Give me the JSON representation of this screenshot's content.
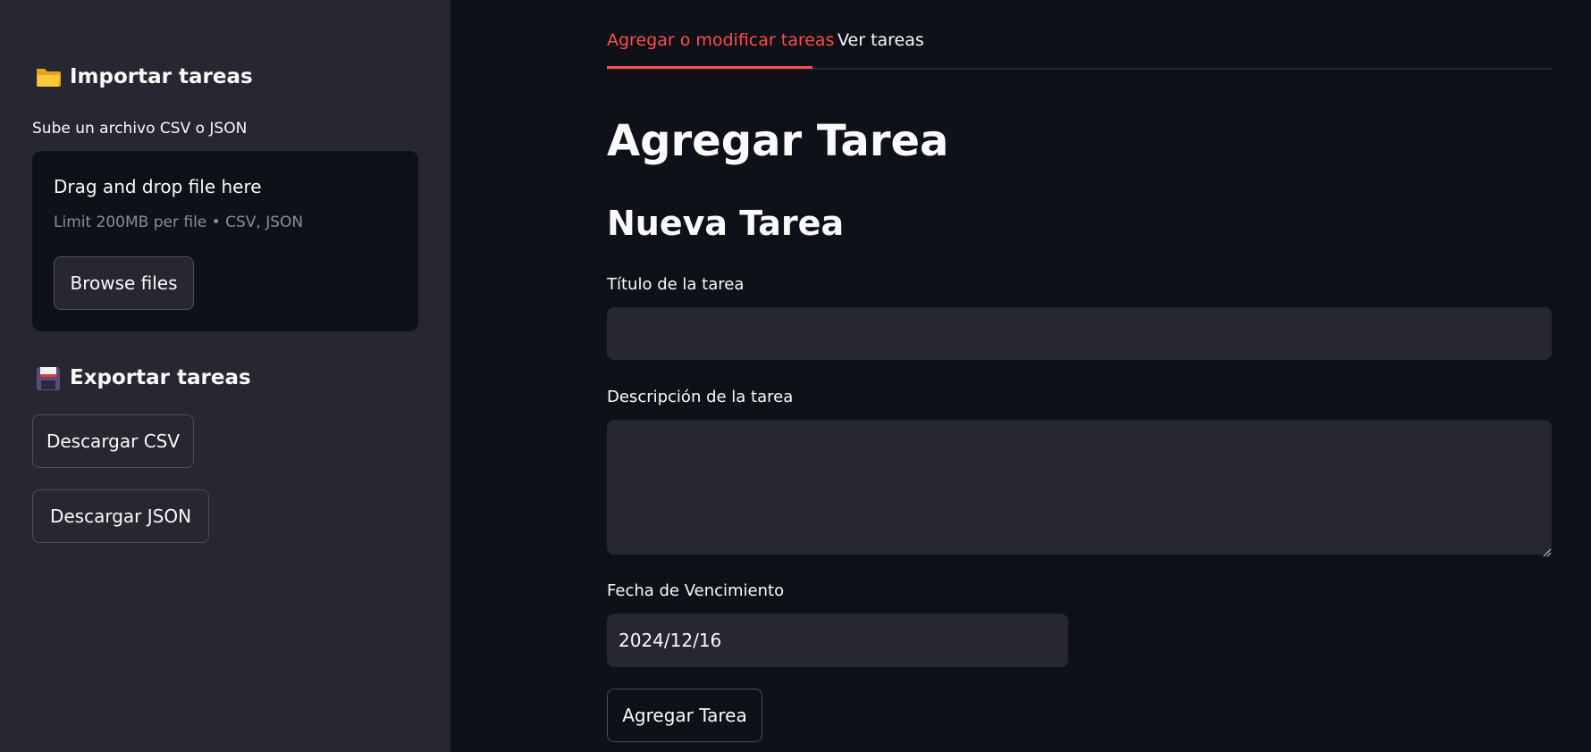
{
  "sidebar": {
    "import": {
      "heading": "Importar tareas",
      "icon": "folder-icon",
      "upload_label": "Sube un archivo CSV o JSON",
      "dropzone_title": "Drag and drop file here",
      "dropzone_limit": "Limit 200MB per file • CSV, JSON",
      "browse_label": "Browse files"
    },
    "export": {
      "heading": "Exportar tareas",
      "icon": "floppy-disk-icon",
      "csv_label": "Descargar CSV",
      "json_label": "Descargar JSON"
    }
  },
  "main": {
    "tabs": [
      {
        "label": "Agregar o modificar tareas",
        "active": true
      },
      {
        "label": "Ver tareas",
        "active": false
      }
    ],
    "page_title": "Agregar Tarea",
    "form_title": "Nueva Tarea",
    "fields": {
      "title_label": "Título de la tarea",
      "title_value": "",
      "description_label": "Descripción de la tarea",
      "description_value": "",
      "due_date_label": "Fecha de Vencimiento",
      "due_date_value": "2024/12/16"
    },
    "submit_label": "Agregar Tarea"
  },
  "colors": {
    "accent": "#ff4b4b",
    "sidebar_bg": "#262730",
    "main_bg": "#0e1117",
    "input_bg": "#262730"
  }
}
